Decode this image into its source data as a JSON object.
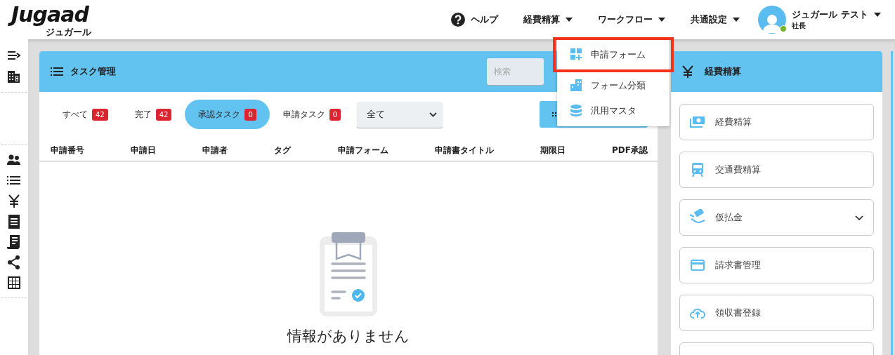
{
  "header": {
    "logo": "Jugaad",
    "logo_sub": "ジュガール",
    "nav": [
      {
        "kind": "help",
        "label": "ヘルプ"
      },
      {
        "kind": "dropdown",
        "label": "経費精算"
      },
      {
        "kind": "dropdown",
        "label": "ワークフロー"
      },
      {
        "kind": "dropdown",
        "label": "共通設定"
      }
    ],
    "user": {
      "name": "ジュガール テスト",
      "role": "社長",
      "online": true
    }
  },
  "dropdown_menu": {
    "items": [
      {
        "label": "申請フォーム",
        "highlighted": true
      },
      {
        "label": "フォーム分類",
        "highlighted": false
      },
      {
        "label": "汎用マスタ",
        "highlighted": false
      }
    ]
  },
  "task_panel": {
    "title": "タスク管理",
    "search": {
      "placeholder": "検索"
    },
    "tabs": [
      {
        "label": "すべて",
        "count": "42",
        "selected": false
      },
      {
        "label": "完了",
        "count": "42",
        "selected": false
      },
      {
        "label": "承認タスク",
        "count": "0",
        "selected": true
      },
      {
        "label": "申請タスク",
        "count": "0",
        "selected": false
      }
    ],
    "filter": {
      "value": "全て"
    },
    "columns": [
      "申請番号",
      "申請日",
      "申請者",
      "タグ",
      "申請フォーム",
      "申請書タイトル",
      "期限日",
      "PDF承認"
    ],
    "empty_message": "情報がありません"
  },
  "expense_panel": {
    "title": "経費精算",
    "items": [
      {
        "label": "経費精算",
        "expandable": false
      },
      {
        "label": "交通費精算",
        "expandable": false
      },
      {
        "label": "仮払金",
        "expandable": true
      },
      {
        "label": "請求書管理",
        "expandable": false
      },
      {
        "label": "領収書登録",
        "expandable": false
      }
    ]
  }
}
